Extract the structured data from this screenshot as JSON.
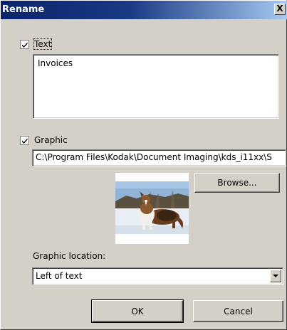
{
  "dialog": {
    "title": "Rename",
    "close_label": "X"
  },
  "text_section": {
    "checkbox_checked": true,
    "label": "Text",
    "value": "Invoices"
  },
  "graphic_section": {
    "checkbox_checked": true,
    "label": "Graphic",
    "path": "C:\\Program Files\\Kodak\\Document Imaging\\kds_i11xx\\S",
    "browse_label": "Browse...",
    "preview_icon": "dog-photo-thumbnail"
  },
  "graphic_location": {
    "label": "Graphic location:",
    "selected": "Left of text"
  },
  "buttons": {
    "ok_label": "OK",
    "cancel_label": "Cancel"
  }
}
